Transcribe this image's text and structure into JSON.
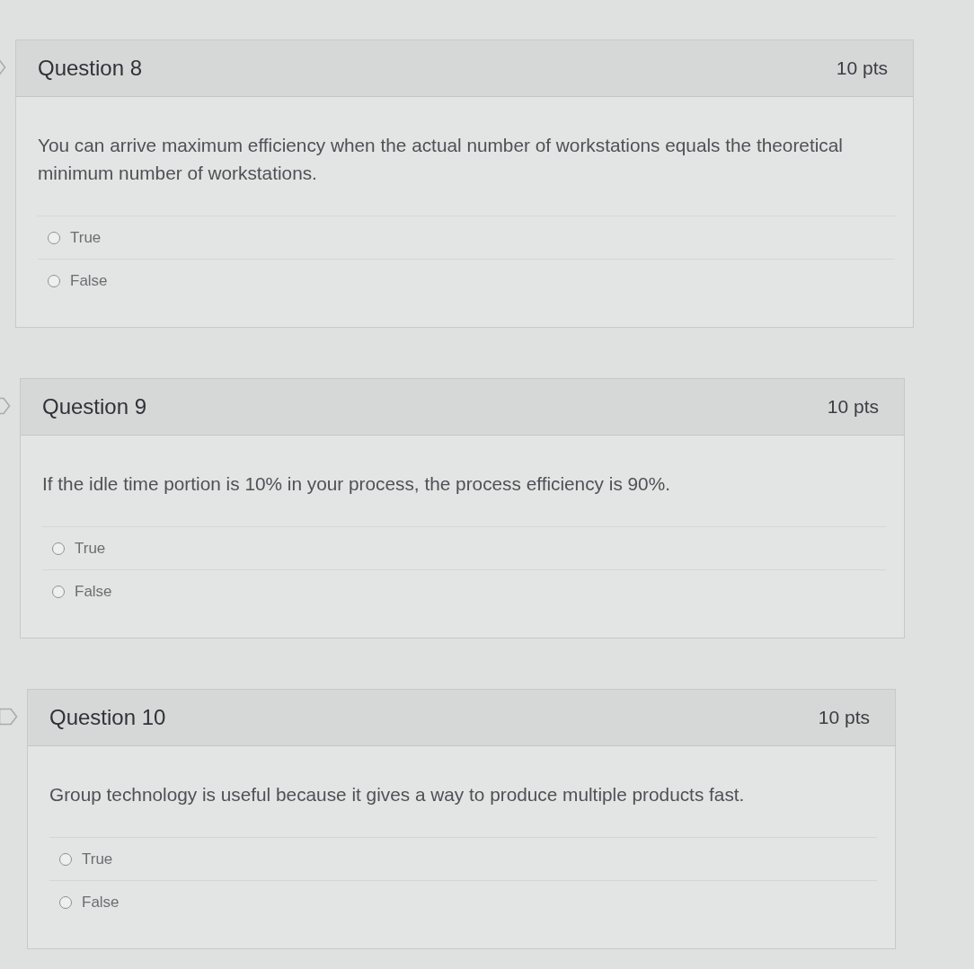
{
  "questions": [
    {
      "title": "Question 8",
      "points": "10 pts",
      "text": "You can arrive maximum efficiency when the actual number of workstations equals the theoretical minimum number of workstations.",
      "answers": [
        {
          "label": "True",
          "selected": false
        },
        {
          "label": "False",
          "selected": false
        }
      ]
    },
    {
      "title": "Question 9",
      "points": "10 pts",
      "text": "If the idle time portion is 10% in your process, the process efficiency is 90%.",
      "answers": [
        {
          "label": "True",
          "selected": false
        },
        {
          "label": "False",
          "selected": false
        }
      ]
    },
    {
      "title": "Question 10",
      "points": "10 pts",
      "text": "Group technology is useful because it gives a way to produce multiple products fast.",
      "answers": [
        {
          "label": "True",
          "selected": false
        },
        {
          "label": "False",
          "selected": false
        }
      ]
    }
  ]
}
